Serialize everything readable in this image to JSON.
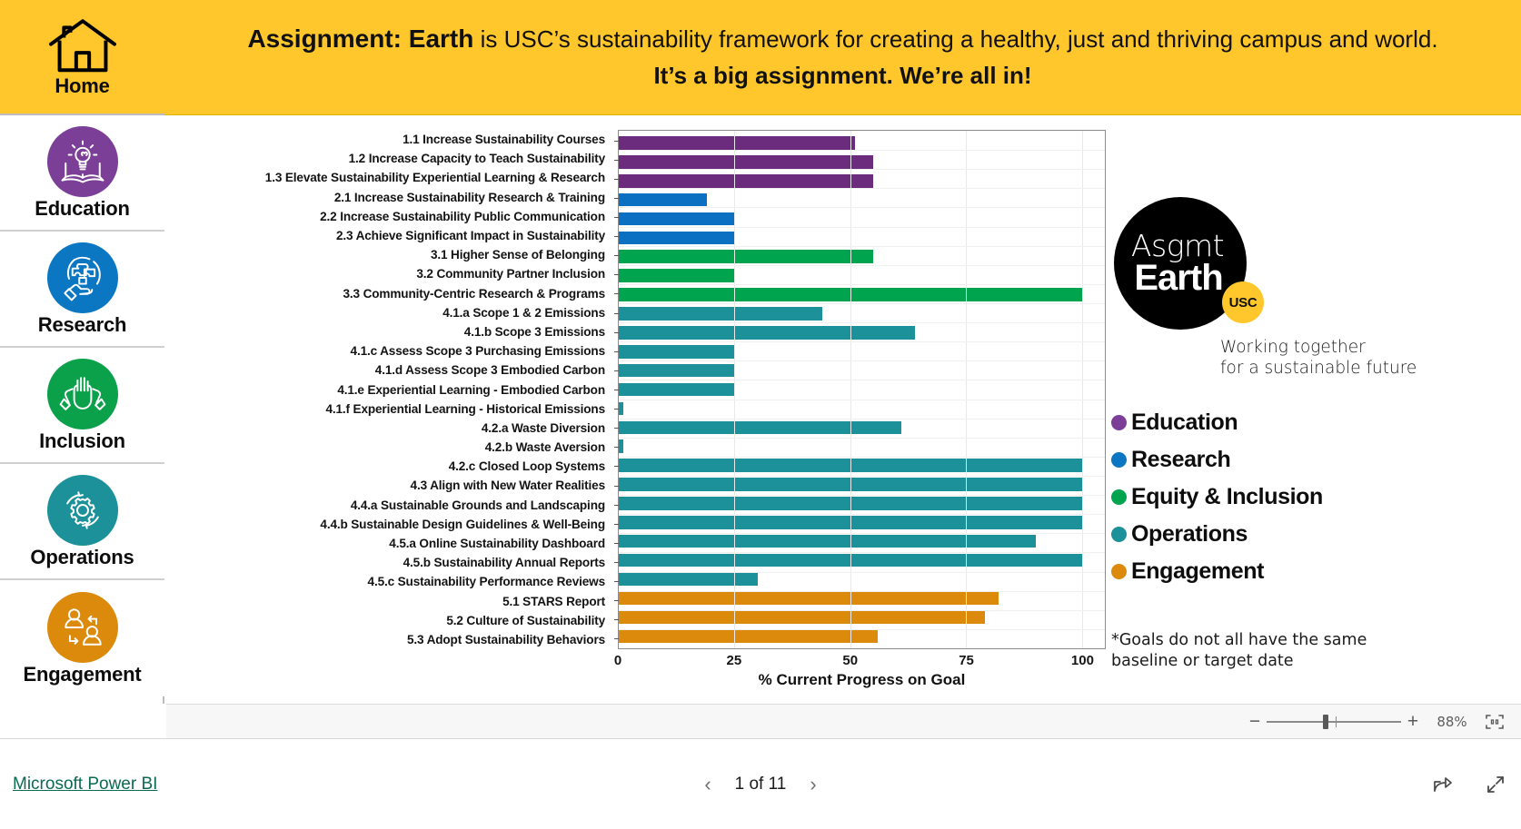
{
  "banner": {
    "line1_strong": "Assignment: Earth",
    "line1_rest": " is USC’s sustainability framework for creating a healthy, just and thriving campus and world.",
    "line2": "It’s a big assignment. We’re all in!",
    "bg_color": "#FFC72C"
  },
  "sidebar": {
    "items": [
      {
        "label": "Home",
        "icon": "house-icon",
        "color": "#FFC72C",
        "active": true
      },
      {
        "label": "Education",
        "icon": "lightbulb-book-icon",
        "color": "#7B3F98",
        "active": false
      },
      {
        "label": "Research",
        "icon": "globe-puzzle-hand-icon",
        "color": "#0B77C2",
        "active": false
      },
      {
        "label": "Inclusion",
        "icon": "clapping-hands-icon",
        "color": "#0BA14B",
        "active": false
      },
      {
        "label": "Operations",
        "icon": "gear-cycle-icon",
        "color": "#1C9199",
        "active": false
      },
      {
        "label": "Engagement",
        "icon": "two-people-exchange-icon",
        "color": "#DC8A0C",
        "active": false
      }
    ]
  },
  "logo": {
    "top_word": "Asgmt",
    "bottom_word": "Earth",
    "badge": "USC",
    "tagline_line1": "Working together",
    "tagline_line2": "for a sustainable future"
  },
  "footnote": "*Goals do not all have the same baseline or target date",
  "zoom_bar": {
    "minus": "−",
    "plus": "+",
    "percent": "88%",
    "fit_icon": "fit-to-page-icon"
  },
  "status_bar": {
    "powerbi_label": "Microsoft Power BI",
    "page_text": "1 of 11",
    "prev_icon": "chevron-left-icon",
    "next_icon": "chevron-right-icon",
    "share_icon": "share-icon",
    "fullscreen_icon": "fullscreen-icon"
  },
  "chart_data": {
    "type": "bar",
    "orientation": "horizontal",
    "title": "",
    "xlabel": "% Current Progress on Goal",
    "ylabel": "",
    "xlim": [
      0,
      105
    ],
    "xticks": [
      0,
      25,
      50,
      75,
      100
    ],
    "grid": true,
    "legend_position": "right",
    "colors": {
      "Education": "#6B2C7E",
      "Research": "#0B6FC2",
      "Equity & Inclusion": "#00A44F",
      "Operations": "#1C9199",
      "Engagement": "#DC8A0C"
    },
    "legend": [
      {
        "label": "Education",
        "color": "#7B3F98"
      },
      {
        "label": "Research",
        "color": "#0B77C2"
      },
      {
        "label": "Equity & Inclusion",
        "color": "#00A44F"
      },
      {
        "label": "Operations",
        "color": "#1C9199"
      },
      {
        "label": "Engagement",
        "color": "#DC8A0C"
      }
    ],
    "categories": [
      "1.1 Increase Sustainability Courses",
      "1.2 Increase Capacity to Teach Sustainability",
      "1.3 Elevate Sustainability Experiential Learning & Research",
      "2.1 Increase Sustainability Research & Training",
      "2.2 Increase Sustainability Public Communication",
      "2.3 Achieve Significant Impact in Sustainability",
      "3.1 Higher Sense of  Belonging",
      "3.2 Community Partner Inclusion",
      "3.3 Community-Centric Research & Programs",
      "4.1.a Scope 1 & 2 Emissions",
      "4.1.b Scope 3 Emissions",
      "4.1.c Assess Scope 3 Purchasing Emissions",
      "4.1.d Assess Scope 3 Embodied Carbon",
      "4.1.e Experiential Learning - Embodied Carbon",
      "4.1.f Experiential Learning - Historical Emissions",
      "4.2.a Waste Diversion",
      "4.2.b Waste Aversion",
      "4.2.c Closed Loop Systems",
      "4.3 Align with New Water Realities",
      "4.4.a Sustainable Grounds and Landscaping",
      "4.4.b Sustainable Design Guidelines & Well-Being",
      "4.5.a Online Sustainability Dashboard",
      "4.5.b Sustainability Annual Reports",
      "4.5.c Sustainability Performance Reviews",
      "5.1 STARS Report",
      "5.2 Culture of Sustainability",
      "5.3 Adopt Sustainability Behaviors"
    ],
    "values": [
      51,
      55,
      55,
      19,
      25,
      25,
      55,
      25,
      100,
      44,
      64,
      25,
      25,
      25,
      1,
      61,
      1,
      100,
      100,
      100,
      100,
      90,
      100,
      30,
      82,
      79,
      56
    ],
    "group": [
      "Education",
      "Education",
      "Education",
      "Research",
      "Research",
      "Research",
      "Equity & Inclusion",
      "Equity & Inclusion",
      "Equity & Inclusion",
      "Operations",
      "Operations",
      "Operations",
      "Operations",
      "Operations",
      "Operations",
      "Operations",
      "Operations",
      "Operations",
      "Operations",
      "Operations",
      "Operations",
      "Operations",
      "Operations",
      "Operations",
      "Engagement",
      "Engagement",
      "Engagement"
    ]
  }
}
